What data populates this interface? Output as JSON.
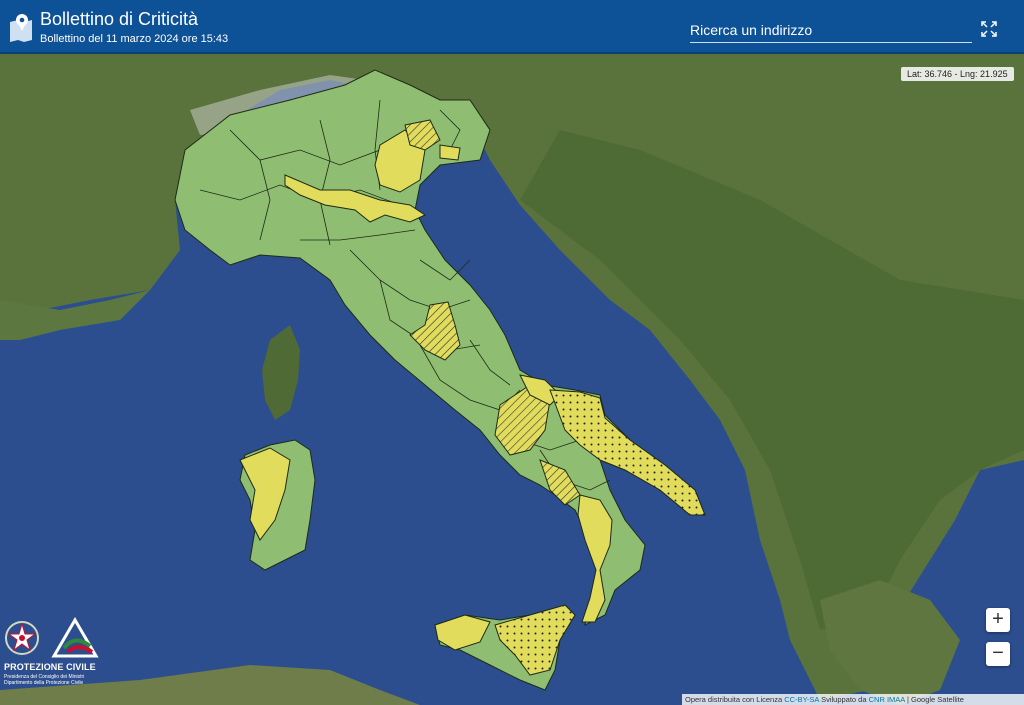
{
  "header": {
    "title": "Bollettino di Criticità",
    "subtitle": "Bollettino del 11 marzo 2024 ore 15:43",
    "search_placeholder": "Ricerca un indirizzo",
    "logo_icon": "map-pin-icon",
    "fullscreen_icon": "fullscreen-icon"
  },
  "map": {
    "coords": "Lat: 36.746 - Lng: 21.925",
    "zoom_in": "+",
    "zoom_out": "−",
    "colors": {
      "sea": "#2c4e8f",
      "land": "#57713b",
      "green_zone": "#8fbe72",
      "yellow_zone": "#e1dc5c",
      "header": "#0d5196"
    }
  },
  "brand": {
    "name": "PROTEZIONE CIVILE",
    "line1": "Presidenza del Consiglio dei Ministri",
    "line2": "Dipartimento della Protezione Civile"
  },
  "attribution": {
    "text1": "Opera distribuita con Licenza",
    "link1": "CC-BY-SA",
    "text2": "Sviluppato da",
    "link2": "CNR IMAA",
    "text3": "| Google Satellite"
  }
}
